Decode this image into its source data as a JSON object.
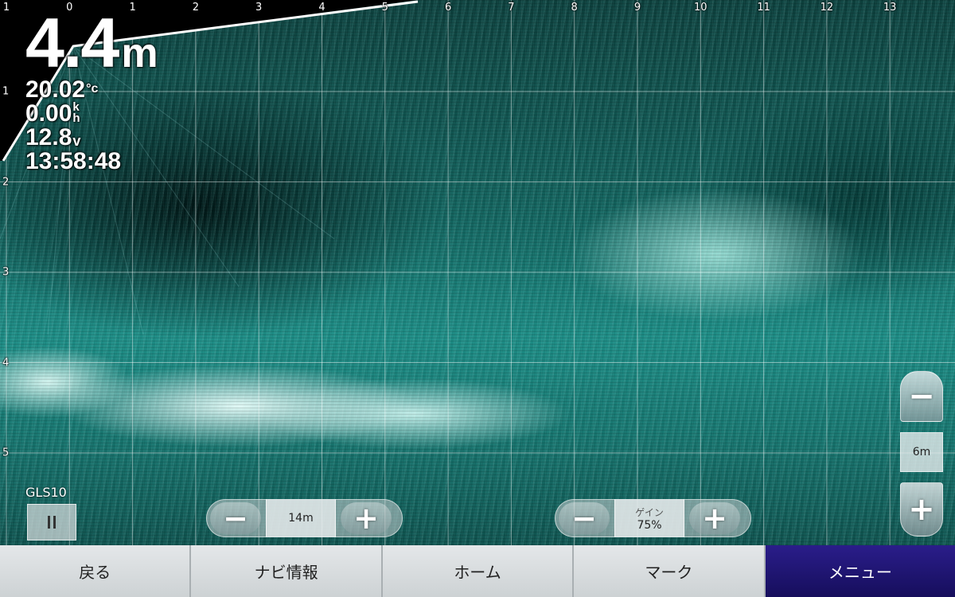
{
  "readout": {
    "depth_value": "4.4",
    "depth_unit": "m",
    "water_temp": "20.02",
    "water_temp_unit": "°c",
    "speed": "0.00",
    "speed_unit_top": "k",
    "speed_unit_bottom": "h",
    "voltage": "12.8",
    "voltage_unit": "v",
    "time": "13:58:48"
  },
  "scale": {
    "top_labels": [
      "1",
      "0",
      "1",
      "2",
      "3",
      "4",
      "5",
      "6",
      "7",
      "8",
      "9",
      "10",
      "11",
      "12",
      "13"
    ],
    "side_labels": [
      "1",
      "2",
      "3",
      "4",
      "5"
    ]
  },
  "range_control": {
    "minus_symbol": "−",
    "value": "14m",
    "plus_symbol": "+"
  },
  "gain_control": {
    "minus_symbol": "−",
    "label": "ゲイン",
    "value": "75%",
    "plus_symbol": "+"
  },
  "zoom_control": {
    "minus_symbol": "−",
    "value": "6m",
    "plus_symbol": "+"
  },
  "device": {
    "name": "GLS10"
  },
  "nav": {
    "items": [
      {
        "label": "戻る",
        "active": false
      },
      {
        "label": "ナビ情報",
        "active": false
      },
      {
        "label": "ホーム",
        "active": false
      },
      {
        "label": "マーク",
        "active": false
      },
      {
        "label": "メニュー",
        "active": true
      }
    ]
  },
  "colors": {
    "sonar_base": "#1d8a83",
    "nav_active": "#1f1473",
    "nav_bg": "#d6dadc"
  }
}
